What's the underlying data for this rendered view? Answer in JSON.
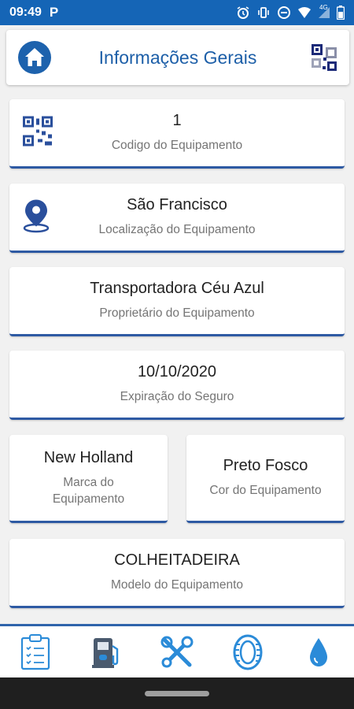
{
  "status_bar": {
    "time": "09:49",
    "app_indicator": "P",
    "network_label": "4G"
  },
  "header": {
    "title": "Informações Gerais"
  },
  "cards": {
    "code": {
      "value": "1",
      "label": "Codigo do Equipamento"
    },
    "location": {
      "value": "São Francisco",
      "label": "Localização do Equipamento"
    },
    "owner": {
      "value": "Transportadora Céu Azul",
      "label": "Proprietário do Equipamento"
    },
    "insurance": {
      "value": "10/10/2020",
      "label": "Expiração do Seguro"
    },
    "brand": {
      "value": "New Holland",
      "label": "Marca do Equipamento"
    },
    "color": {
      "value": "Preto Fosco",
      "label": "Cor do Equipamento"
    },
    "model": {
      "value": "COLHEITADEIRA",
      "label": "Modelo do Equipamento"
    }
  },
  "bottom_nav": {
    "items": [
      {
        "icon": "clipboard-icon"
      },
      {
        "icon": "fuel-pump-icon"
      },
      {
        "icon": "tools-icon"
      },
      {
        "icon": "tire-icon"
      },
      {
        "icon": "water-drop-icon"
      }
    ]
  },
  "colors": {
    "accent": "#1565b6",
    "title": "#1d5fa8",
    "card_border": "#2e5aa3",
    "icon_blue": "#2b8bd8"
  }
}
